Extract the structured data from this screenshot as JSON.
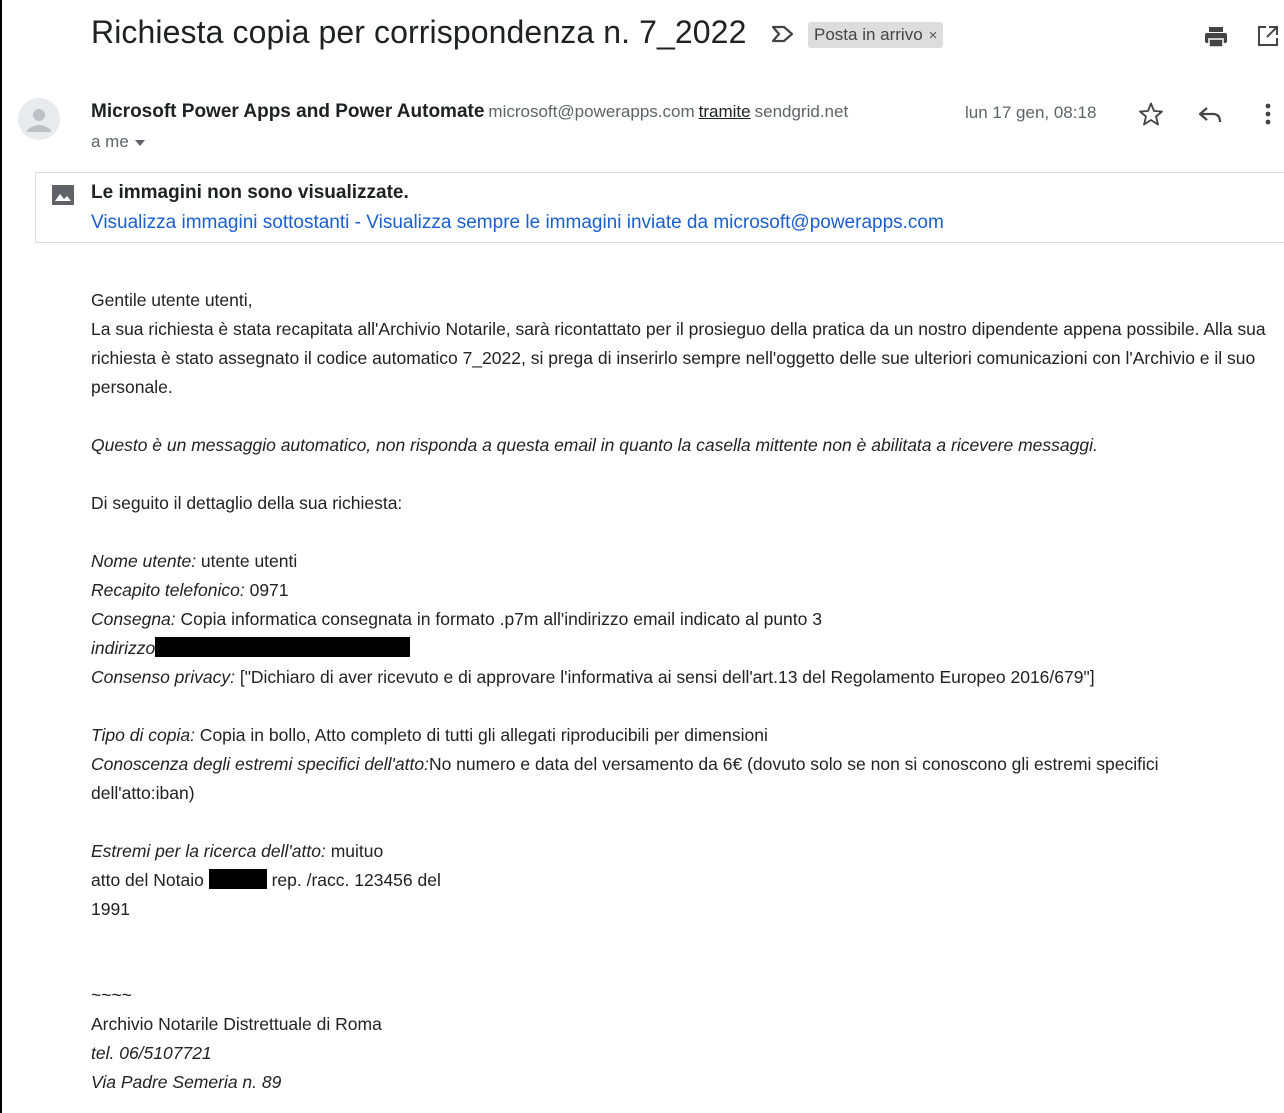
{
  "header": {
    "subject": "Richiesta copia per corrispondenza n. 7_2022",
    "label": "Posta in arrivo",
    "label_close": "×",
    "icons": [
      "importance-marker-icon",
      "print-icon",
      "open-in-new-window-icon"
    ]
  },
  "sender": {
    "name": "Microsoft Power Apps and Power Automate",
    "email": "microsoft@powerapps.com",
    "via_label": "tramite",
    "via_domain": "sendgrid.net",
    "to": "a me",
    "date": "lun 17 gen, 08:18",
    "icons": [
      "avatar",
      "star-icon",
      "reply-icon",
      "more-icon"
    ]
  },
  "images_notice": {
    "title": "Le immagini non sono visualizzate.",
    "link_show": "Visualizza immagini sottostanti",
    "separator": " - ",
    "link_always": "Visualizza sempre le immagini inviate da microsoft@powerapps.com"
  },
  "body": {
    "greeting": "Gentile utente utenti,",
    "paragraph": "La sua richiesta è stata recapitata all'Archivio Notarile, sarà ricontattato per il prosieguo della pratica da un nostro dipendente appena possibile. Alla sua richiesta è stato assegnato il codice automatico 7_2022, si prega di inserirlo sempre nell'oggetto delle sue ulteriori comunicazioni con l'Archivio e il suo personale.",
    "auto_notice": "Questo è un messaggio automatico, non risponda a questa email in quanto la casella mittente non è abilitata a ricevere messaggi.",
    "detail_intro": "Di seguito il dettaglio della sua richiesta:",
    "nome_label": "Nome utente:",
    "nome_value": " utente utenti",
    "recapito_label": "Recapito telefonico:",
    "recapito_value": " 0971",
    "consegna_label": "Consegna:",
    "consegna_value": " Copia informatica consegnata in formato .p7m all'indirizzo email indicato al punto 3",
    "indirizzo_label": "indirizzo",
    "consenso_label": "Consenso privacy:",
    "consenso_value": " [\"Dichiaro di aver ricevuto e di approvare l'informativa ai sensi dell'art.13 del Regolamento Europeo 2016/679\"]",
    "tipo_label": "Tipo di copia:",
    "tipo_value": " Copia in bollo,  Atto completo di tutti gli allegati riproducibili per dimensioni",
    "conoscenza_label": "Conoscenza degli estremi specifici dell'atto:",
    "conoscenza_value": "No numero e data del versamento da 6€ (dovuto solo se non si conoscono gli estremi specifici",
    "conoscenza_cont": "dell'atto:iban)",
    "estremi_label": "Estremi per la ricerca dell'atto:",
    "estremi_value": " muituo",
    "atto_prefix": "atto del Notaio ",
    "atto_suffix": " rep. /racc.  123456 del",
    "atto_year": "1991",
    "signature_sep": "~~~~",
    "signature_org": "Archivio Notarile Distrettuale di Roma",
    "signature_tel": "tel. 06/5107721",
    "signature_addr": "Via Padre Semeria n. 89"
  }
}
